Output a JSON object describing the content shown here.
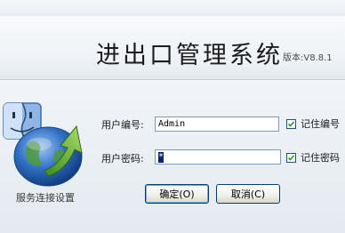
{
  "header": {
    "title": "进出口管理系统",
    "version": "版本:V8.8.1"
  },
  "sidebar": {
    "server_settings_label": "服务连接设置"
  },
  "form": {
    "user_id_label": "用户编号:",
    "user_id_value": "Admin",
    "password_label": "用户密码:",
    "password_mask": "*",
    "remember_id_label": "记住编号",
    "remember_id_checked": true,
    "remember_password_label": "记住密码",
    "remember_password_checked": true
  },
  "buttons": {
    "ok_label": "确定(O)",
    "cancel_label": "取消(C)"
  },
  "icons": {
    "finder": "finder-icon",
    "globe": "globe-arrow-icon",
    "check": "checkmark-icon"
  },
  "colors": {
    "input_border": "#7f9db9",
    "button_border": "#003c74",
    "globe_blue": "#2f6fc4",
    "arrow_green": "#5aa82a"
  }
}
